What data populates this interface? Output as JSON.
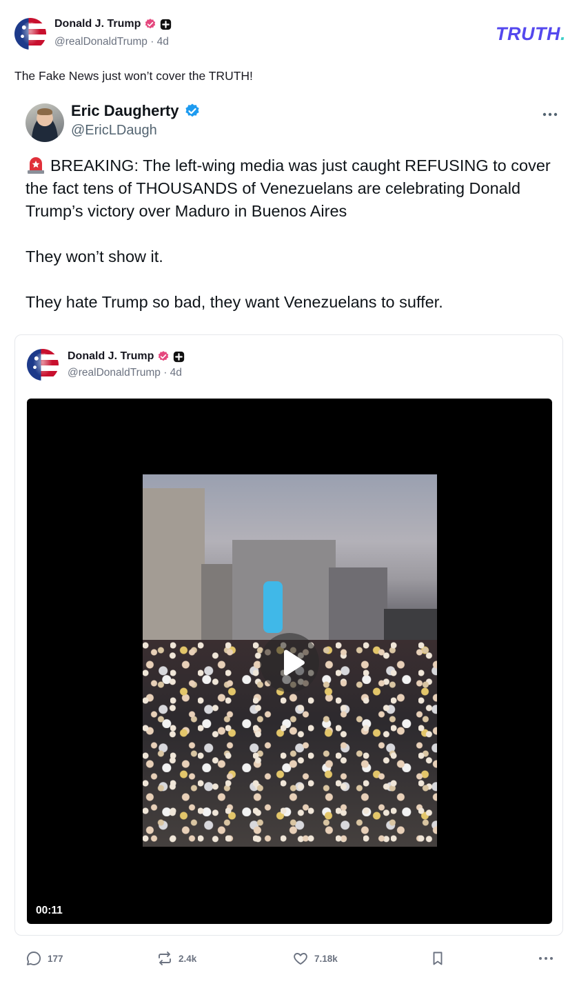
{
  "post": {
    "author_name": "Donald J. Trump",
    "author_handle": "@realDonaldTrump · 4d",
    "caption": "The Fake News just won’t cover the TRUTH!",
    "logo": "TRUTH",
    "logo_dot": "."
  },
  "tweet": {
    "author_name": "Eric Daugherty",
    "author_handle": "@EricLDaugh",
    "paragraphs": [
      "BREAKING: The left-wing media was just caught REFUSING to cover the fact tens of THOUSANDS of Venezuelans are celebrating Donald Trump’s victory over Maduro in Buenos Aires",
      "They won’t show it.",
      "They hate Trump so bad, they want Venezuelans to suffer."
    ],
    "icons": {
      "badge": "verified-check-icon",
      "emoji": "siren-emoji",
      "menu": "more-horizontal-icon"
    }
  },
  "quoted": {
    "author_name": "Donald J. Trump",
    "author_handle": "@realDonaldTrump · 4d",
    "video_duration": "00:11"
  },
  "actions": {
    "replies": "177",
    "retruths": "2.4k",
    "likes": "7.18k"
  },
  "colors": {
    "brand": "#5448ee",
    "brand_dot": "#3fd0c9",
    "verified_pink": "#e5487e",
    "verified_blue": "#1d9bf0",
    "muted": "#6b7280"
  }
}
